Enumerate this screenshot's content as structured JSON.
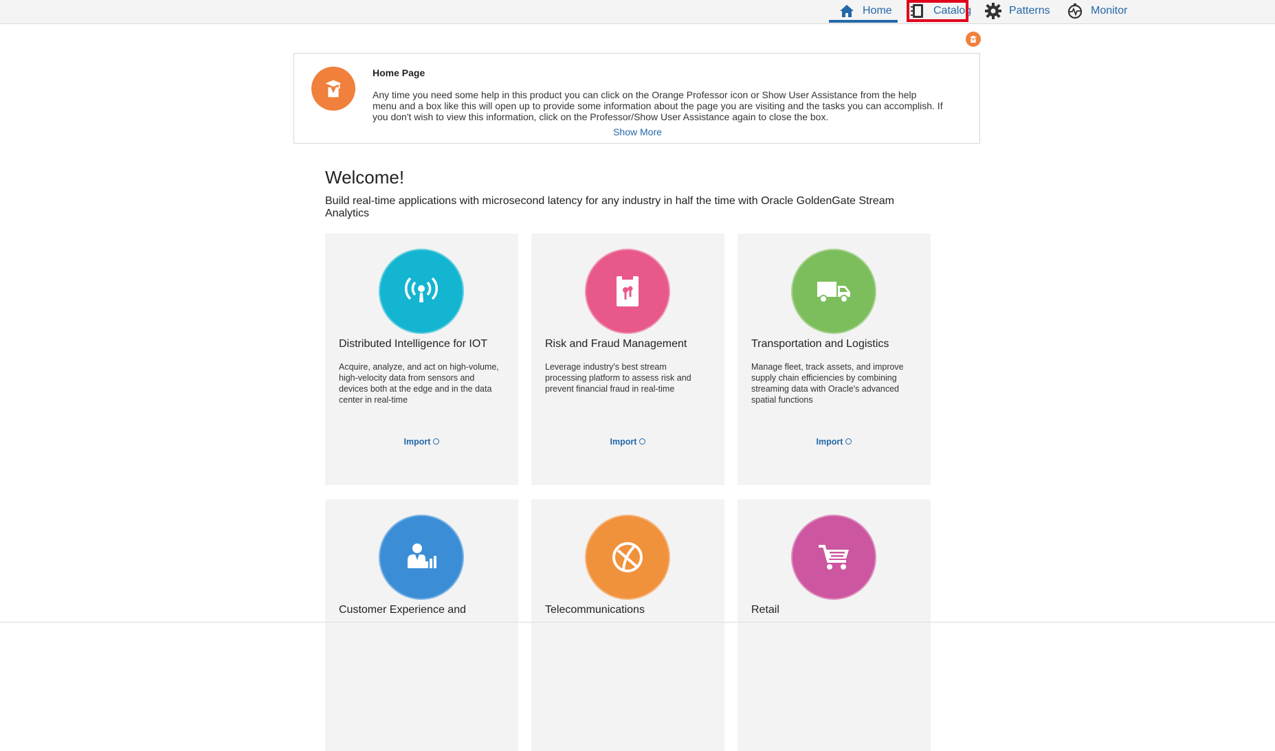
{
  "nav": {
    "home": {
      "label": "Home",
      "icon": "home-icon"
    },
    "catalog": {
      "label": "Catalog",
      "icon": "catalog-book-icon"
    },
    "patterns": {
      "label": "Patterns",
      "icon": "gear-icon"
    },
    "monitor": {
      "label": "Monitor",
      "icon": "monitor-pulse-icon"
    },
    "active_color": "#2467a8",
    "highlight_color": "#e0001b"
  },
  "help": {
    "title": "Home Page",
    "body": "Any time you need some help in this product you can click on the Orange Professor icon or Show User Assistance from the help menu and a box like this will open up to provide some information about the page you are visiting and the tasks you can accomplish. If you don't wish to view this information, click on the Professor/Show User Assistance again to close the box.",
    "show_more": "Show More",
    "icon": "professor-icon",
    "accent": "#f0803c"
  },
  "welcome": {
    "title": "Welcome!",
    "subtitle": "Build real-time applications with microsecond latency for any industry in half the time with Oracle GoldenGate Stream Analytics"
  },
  "cards": [
    {
      "title": "Distributed Intelligence for IOT",
      "description": "Acquire, analyze, and act on high-volume, high-velocity data from sensors and devices both at the edge and in the data center in real-time",
      "import_label": "Import",
      "icon": "wireless-signal-icon",
      "color": "#14b5d1"
    },
    {
      "title": "Risk and Fraud Management",
      "description": "Leverage industry's best stream processing platform to assess risk and prevent financial fraud in real-time",
      "import_label": "Import",
      "icon": "security-key-icon",
      "color": "#e8588a"
    },
    {
      "title": "Transportation and Logistics",
      "description": "Manage fleet, track assets, and improve supply chain efficiencies by combining streaming data with Oracle's advanced spatial functions",
      "import_label": "Import",
      "icon": "truck-icon",
      "color": "#7dbe5c"
    },
    {
      "title": "Customer Experience and",
      "icon": "customer-analytics-icon",
      "color": "#3b8ed6"
    },
    {
      "title": "Telecommunications",
      "icon": "globe-network-icon",
      "color": "#f0923c"
    },
    {
      "title": "Retail",
      "icon": "shopping-cart-icon",
      "color": "#cc569f"
    }
  ]
}
